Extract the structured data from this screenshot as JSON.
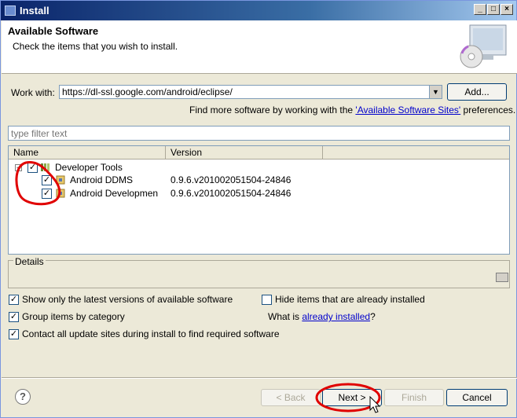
{
  "window": {
    "title": "Install"
  },
  "header": {
    "title": "Available Software",
    "subtitle": "Check the items that you wish to install."
  },
  "work_with": {
    "label": "Work with:",
    "value": "https://dl-ssl.google.com/android/eclipse/",
    "add_label": "Add...",
    "more_prefix": "Find more software by working with the ",
    "more_link": "'Available Software Sites'",
    "more_suffix": " preferences."
  },
  "filter": {
    "placeholder": "type filter text"
  },
  "tree": {
    "columns": [
      "Name",
      "Version"
    ],
    "group": {
      "name": "Developer Tools",
      "checked": true
    },
    "items": [
      {
        "name": "Android DDMS",
        "version": "0.9.6.v201002051504-24846",
        "checked": true
      },
      {
        "name": "Android Development Tc",
        "version": "0.9.6.v201002051504-24846",
        "checked": true
      }
    ]
  },
  "details": {
    "label": "Details"
  },
  "options": {
    "latest": "Show only the latest versions of available software",
    "hide_installed": "Hide items that are already installed",
    "group": "Group items by category",
    "what_is_prefix": "What is ",
    "what_is_link": "already installed",
    "what_is_suffix": "?",
    "contact": "Contact all update sites during install to find required software"
  },
  "buttons": {
    "back": "< Back",
    "next": "Next >",
    "finish": "Finish",
    "cancel": "Cancel",
    "help": "?"
  },
  "colors": {
    "title_bar": "#0a246a",
    "link": "#0000cc",
    "annotation": "#e00000"
  }
}
